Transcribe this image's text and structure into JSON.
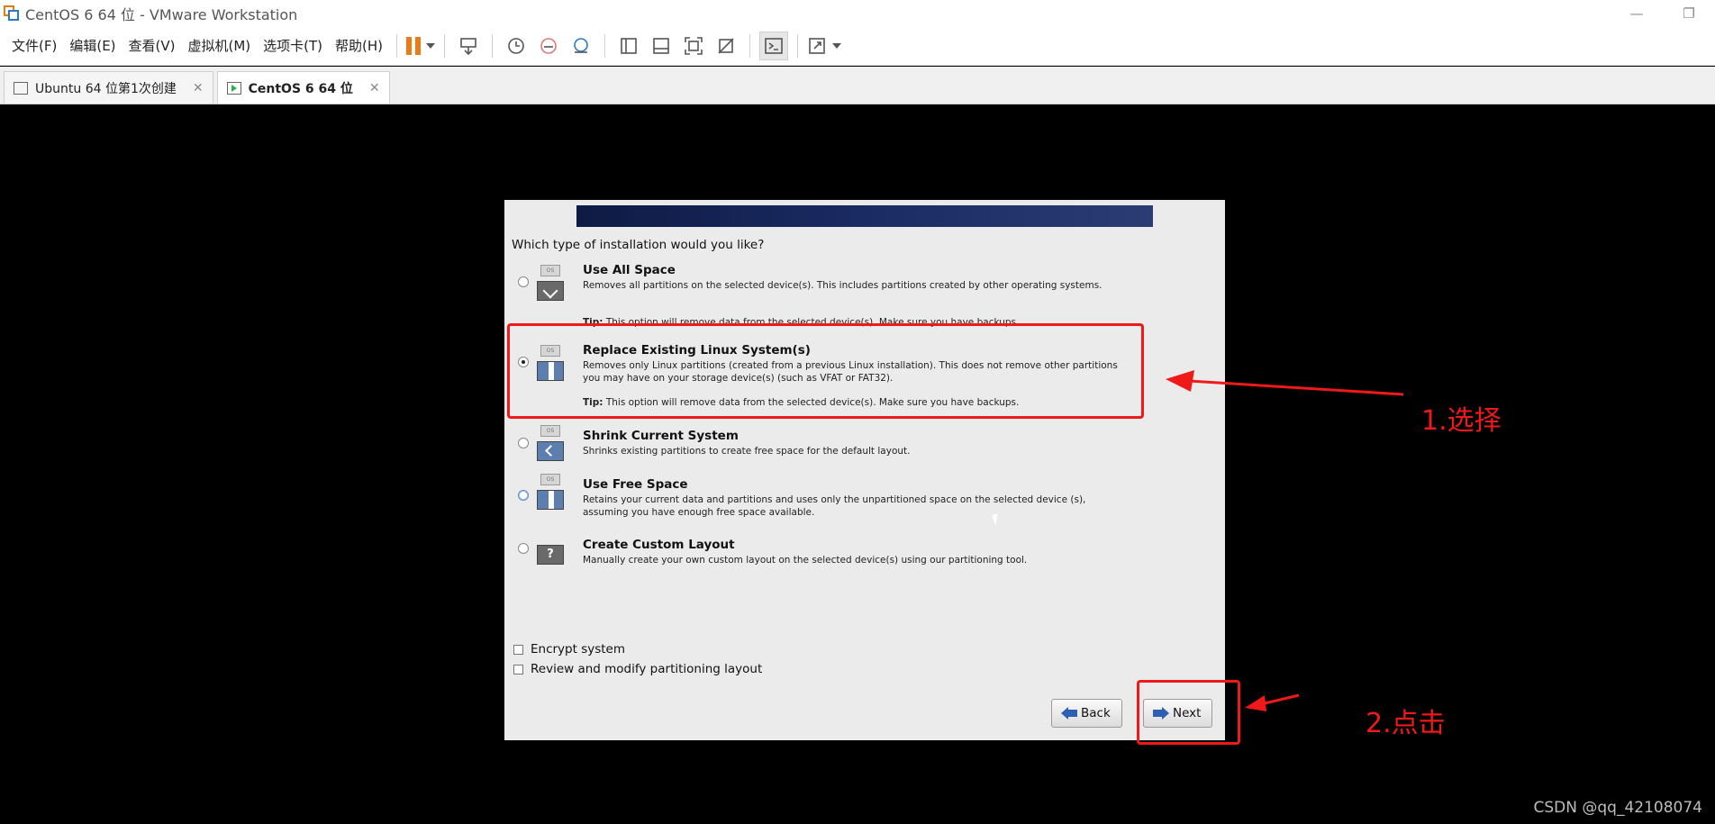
{
  "window": {
    "title": "CentOS 6 64 位 - VMware Workstation",
    "controls": [
      "—",
      "❐",
      "✕"
    ]
  },
  "menu": [
    "文件(F)",
    "编辑(E)",
    "查看(V)",
    "虚拟机(M)",
    "选项卡(T)",
    "帮助(H)"
  ],
  "tabs": [
    {
      "label": "Ubuntu 64 位第1次创建",
      "close": "✕"
    },
    {
      "label": "CentOS 6 64 位",
      "close": "✕"
    }
  ],
  "installer": {
    "question": "Which type of installation would you like?",
    "options": [
      {
        "title": "Use All Space",
        "desc": "Removes all partitions on the selected device(s).  This includes partitions created by other operating systems.",
        "tip_label": "Tip:",
        "tip": "This option will remove data from the selected device(s).  Make sure you have backups.",
        "disk_label": "OS"
      },
      {
        "title": "Replace Existing Linux System(s)",
        "desc": "Removes only Linux partitions (created from a previous Linux installation).  This does not remove other partitions you may have on your storage device(s) (such as VFAT or FAT32).",
        "tip_label": "Tip:",
        "tip": "This option will remove data from the selected device(s).  Make sure you have backups.",
        "disk_label": "OS"
      },
      {
        "title": "Shrink Current System",
        "desc": "Shrinks existing partitions to create free space for the default layout.",
        "disk_label": "OS"
      },
      {
        "title": "Use Free Space",
        "desc": "Retains your current data and partitions and uses only the unpartitioned space on the selected device (s), assuming you have enough free space available.",
        "disk_label": "OS"
      },
      {
        "title": "Create Custom Layout",
        "desc": "Manually create your own custom layout on the selected device(s) using our partitioning tool.",
        "icon_glyph": "?"
      }
    ],
    "checkboxes": [
      "Encrypt system",
      "Review and modify partitioning layout"
    ],
    "back_label": "Back",
    "next_label": "Next"
  },
  "annotations": {
    "step1": "1.选择",
    "step2": "2.点击",
    "color": "#f01919"
  },
  "watermark": "CSDN @qq_42108074"
}
